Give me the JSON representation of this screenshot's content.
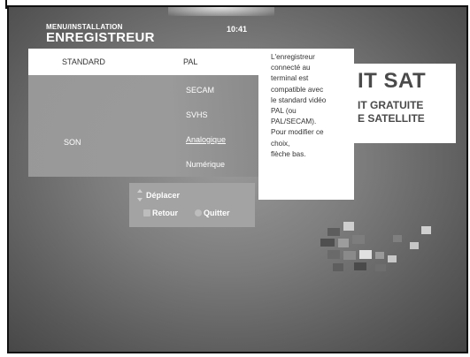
{
  "header": {
    "menu_path": "MENU/INSTALLATION",
    "title": "ENREGISTREUR",
    "time": "10:41"
  },
  "settings": {
    "standard_label": "STANDARD",
    "standard_value": "PAL",
    "son_label": "SON",
    "options": [
      "SECAM",
      "SVHS",
      "Analogique",
      "Numérique"
    ],
    "selected_option": "Analogique"
  },
  "help": {
    "lines": [
      "L'enregistreur",
      "connecté au",
      "terminal est",
      "compatible avec",
      "le standard vidéo",
      "PAL (ou",
      "PAL/SECAM).",
      "Pour modifier ce",
      "choix,",
      "flèche bas."
    ]
  },
  "brand": {
    "line1": "IT SAT",
    "line2": "IT GRATUITE",
    "line3": "E SATELLITE"
  },
  "keys": {
    "move_label": "Déplacer",
    "back_label": "Retour",
    "quit_label": "Quitter"
  }
}
